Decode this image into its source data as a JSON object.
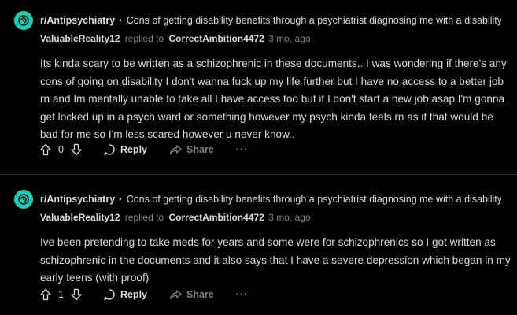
{
  "comments": [
    {
      "subreddit": "r/Antipsychiatry",
      "separator": "•",
      "post_title": "Cons of getting disability benefits through a psychiatrist diagnosing me with a disability?",
      "author": "ValuableReality12",
      "replied_to_label": "replied to",
      "replied_to_user": "CorrectAmbition4472",
      "time": "3 mo. ago",
      "body": "Its kinda scary to be written as a schizophrenic in these documents.. I was wondering if there's any cons of going on disability I don't wanna fuck up my life further but I have no access to a better job rn and Im mentally unable to take all I have access too but if I don't start a new job asap I'm gonna get locked up in a psych ward or something however my psych kinda feels rn as if that would be bad for me so I'm less scared however u never know..",
      "votes": "0",
      "reply_label": "Reply",
      "share_label": "Share",
      "more_label": "···"
    },
    {
      "subreddit": "r/Antipsychiatry",
      "separator": "•",
      "post_title": "Cons of getting disability benefits through a psychiatrist diagnosing me with a disability?",
      "author": "ValuableReality12",
      "replied_to_label": "replied to",
      "replied_to_user": "CorrectAmbition4472",
      "time": "3 mo. ago",
      "body": "Ive been pretending to take meds for years and some were for schizophrenics so I got written as schizophrenic in the documents and it also says that I have a severe depression which began in my early teens (with proof)",
      "votes": "1",
      "reply_label": "Reply",
      "share_label": "Share",
      "more_label": "···"
    }
  ],
  "colors": {
    "background": "#000000",
    "subreddit_avatar": "#0dd3bb",
    "text": "#d7dadc",
    "muted": "#818384",
    "divider": "#2a2c2e"
  },
  "icons": {
    "subreddit_avatar": "antipsychiatry-community-icon",
    "upvote": "arrow-up-icon",
    "downvote": "arrow-down-icon",
    "reply": "speech-bubble-icon",
    "share": "share-arrow-icon"
  }
}
